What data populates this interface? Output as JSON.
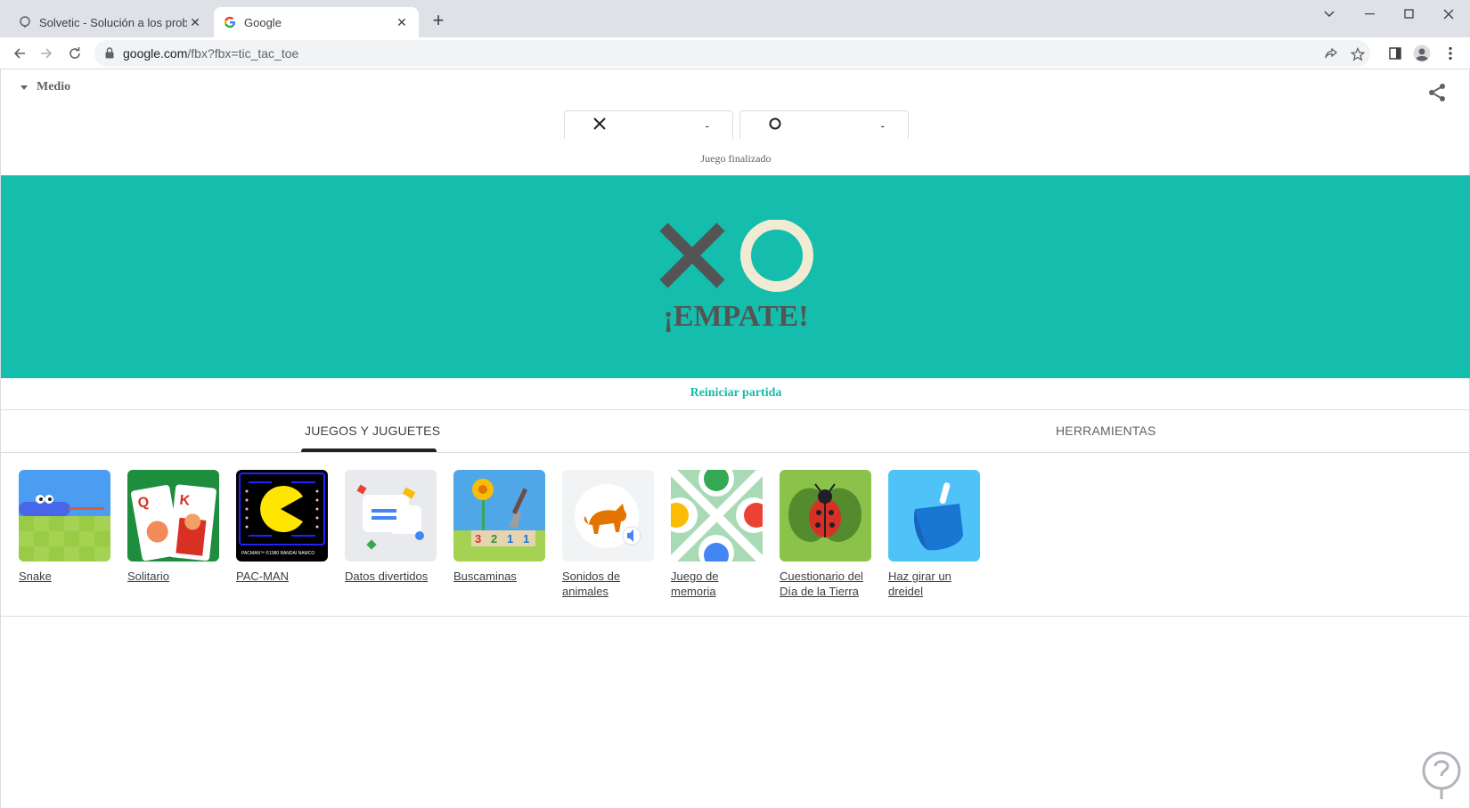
{
  "tabs": [
    {
      "title": "Solvetic - Solución a los problem",
      "active": false
    },
    {
      "title": "Google",
      "active": true
    }
  ],
  "window_controls": [
    "tab-search-icon",
    "minimize-icon",
    "maximize-icon",
    "close-icon"
  ],
  "address_bar": {
    "url_host": "google.com",
    "url_path": "/fbx?fbx=tic_tac_toe"
  },
  "game": {
    "difficulty": "Medio",
    "players": [
      {
        "mark": "X",
        "score": "-"
      },
      {
        "mark": "O",
        "score": "-"
      }
    ],
    "status": "Juego finalizado",
    "result": "¡EMPATE!",
    "restart_label": "Reiniciar partida",
    "colors": {
      "banner": "#14bdac",
      "x_mark": "#545454",
      "o_mark": "#f2ebd3"
    }
  },
  "category_tabs": [
    {
      "label": "JUEGOS Y JUGUETES",
      "active": true
    },
    {
      "label": "HERRAMIENTAS",
      "active": false
    }
  ],
  "games": [
    {
      "name": "Snake",
      "icon": "snake-thumbnail"
    },
    {
      "name": "Solitario",
      "icon": "solitaire-thumbnail"
    },
    {
      "name": "PAC-MAN",
      "icon": "pacman-thumbnail",
      "caption": "PACMAN™ ©1980 BANDAI NAMCO"
    },
    {
      "name": "Datos divertidos",
      "icon": "fun-facts-thumbnail"
    },
    {
      "name": "Buscaminas",
      "icon": "minesweeper-thumbnail",
      "numbers": [
        "3",
        "2",
        "1",
        "1"
      ]
    },
    {
      "name": "Sonidos de animales",
      "icon": "animal-sounds-thumbnail"
    },
    {
      "name": "Juego de memoria",
      "icon": "memory-game-thumbnail"
    },
    {
      "name": "Cuestionario del Día de la Tierra",
      "icon": "earth-day-quiz-thumbnail"
    },
    {
      "name": "Haz girar un dreidel",
      "icon": "dreidel-thumbnail"
    }
  ]
}
